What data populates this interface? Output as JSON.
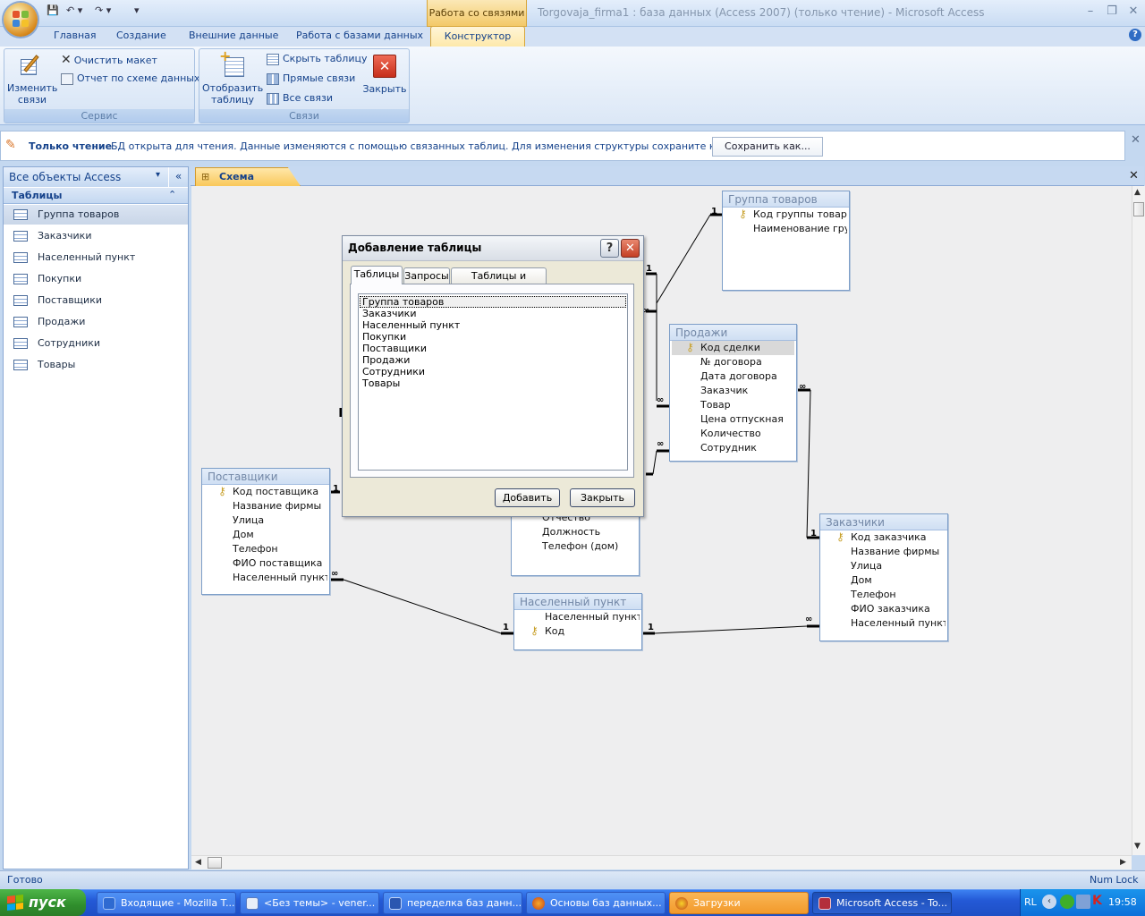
{
  "window": {
    "title": "Torgovaja_firma1 : база данных (Access 2007) (только чтение) - Microsoft Access",
    "context_tab_group": "Работа со связями"
  },
  "ribbon": {
    "tabs": [
      "Главная",
      "Создание",
      "Внешние данные",
      "Работа с базами данных",
      "Конструктор"
    ],
    "active_tab": "Конструктор",
    "groups": {
      "service": {
        "caption": "Сервис",
        "edit_relations": "Изменить связи",
        "clear_layout": "Очистить макет",
        "schema_report": "Отчет по схеме данных"
      },
      "relations": {
        "caption": "Связи",
        "show_table": "Отобразить таблицу",
        "hide_table": "Скрыть таблицу",
        "direct_relations": "Прямые связи",
        "all_relations": "Все связи",
        "close": "Закрыть"
      }
    }
  },
  "message_bar": {
    "title": "Только чтение",
    "text": "БД открыта для чтения. Данные изменяются с помощью связанных таблиц. Для изменения структуры сохраните копию БД.",
    "button": "Сохранить как..."
  },
  "nav_pane": {
    "header": "Все объекты Access",
    "group": "Таблицы",
    "items": [
      "Группа товаров",
      "Заказчики",
      "Населенный пункт",
      "Покупки",
      "Поставщики",
      "Продажи",
      "Сотрудники",
      "Товары"
    ],
    "selected": "Группа товаров"
  },
  "document": {
    "tab": "Схема данных"
  },
  "schema_tables": {
    "gruppa": {
      "title": "Группа товаров",
      "fields": [
        "Код группы товаров",
        "Наименование группы"
      ]
    },
    "prodazhi": {
      "title": "Продажи",
      "fields": [
        "Код сделки",
        "№ договора",
        "Дата договора",
        "Заказчик",
        "Товар",
        "Цена отпускная",
        "Количество",
        "Сотрудник"
      ]
    },
    "postavshiki": {
      "title": "Поставщики",
      "fields": [
        "Код поставщика",
        "Название фирмы",
        "Улица",
        "Дом",
        "Телефон",
        "ФИО поставщика",
        "Населенный пункт"
      ]
    },
    "sotrudniki_partial": {
      "fields": [
        "Отчество",
        "Должность",
        "Телефон (дом)"
      ]
    },
    "nas_punkt": {
      "title": "Населенный пункт",
      "fields": [
        "Населенный пункт",
        "Код"
      ]
    },
    "zakazchiki": {
      "title": "Заказчики",
      "fields": [
        "Код заказчика",
        "Название фирмы",
        "Улица",
        "Дом",
        "Телефон",
        "ФИО заказчика",
        "Населенный пункт"
      ]
    }
  },
  "relation_marks": {
    "one": "1",
    "many": "∞"
  },
  "dialog": {
    "title": "Добавление таблицы",
    "tabs": [
      "Таблицы",
      "Запросы",
      "Таблицы и запросы"
    ],
    "active_tab": "Таблицы",
    "items": [
      "Группа товаров",
      "Заказчики",
      "Населенный пункт",
      "Покупки",
      "Поставщики",
      "Продажи",
      "Сотрудники",
      "Товары"
    ],
    "selected": "Группа товаров",
    "add_button": "Добавить",
    "close_button": "Закрыть"
  },
  "status_bar": {
    "left": "Готово",
    "right": "Num Lock"
  },
  "taskbar": {
    "start": "пуск",
    "tasks": [
      "Входящие - Mozilla T...",
      "<Без темы> - vener...",
      "переделка баз данн...",
      "Основы баз данных...",
      "Загрузки",
      "Microsoft Access - To..."
    ],
    "tray_lang": "RL",
    "clock": "19:58"
  }
}
